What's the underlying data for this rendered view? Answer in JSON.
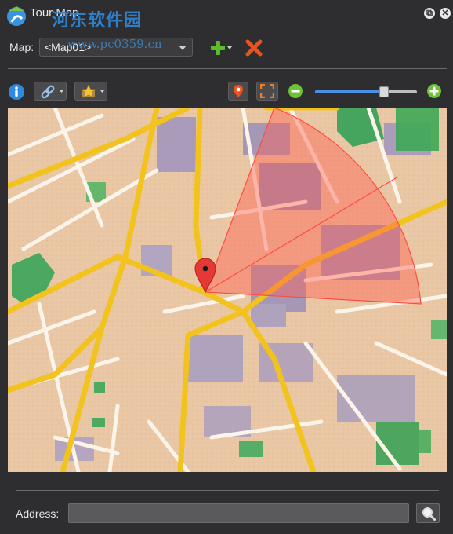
{
  "window": {
    "title": "Tour Map",
    "watermark": "河东软件园",
    "watermark_url": "www.pc0359.cn"
  },
  "map_selector": {
    "label": "Map:",
    "selected": "<Map01>"
  },
  "toolbar": {
    "zoom_level": 0.68
  },
  "address": {
    "label": "Address:",
    "value": ""
  },
  "colors": {
    "accent": "#4a90e2",
    "add_green": "#5bbd2b",
    "delete_red": "#e8531f",
    "pin_red": "#e53935",
    "fov_cone": "#ff5a4e"
  },
  "icons": {
    "info": "info-icon",
    "link": "link-icon",
    "bookmark": "bookmark-star-icon",
    "pin": "map-pin-icon",
    "fit": "fit-screen-icon",
    "zoom_out": "zoom-out-icon",
    "zoom_in": "zoom-in-icon",
    "search": "search-icon"
  }
}
